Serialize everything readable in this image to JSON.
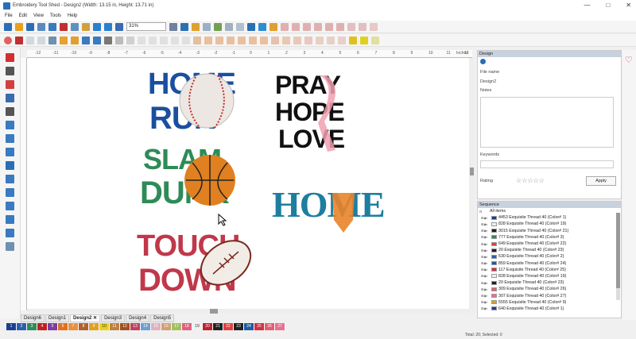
{
  "window": {
    "title": "Embroidery Tool Shed - Design2 (Width: 13.15 in, Height: 13.71 in)",
    "min": "—",
    "max": "□",
    "close": "✕"
  },
  "menu": [
    "File",
    "Edit",
    "View",
    "Tools",
    "Help"
  ],
  "toolbar": {
    "zoom": "31%"
  },
  "ruler": {
    "units": "Inches",
    "ticks": [
      "-12",
      "-11",
      "-10",
      "-9",
      "-8",
      "-7",
      "-6",
      "-5",
      "-4",
      "-3",
      "-2",
      "-1",
      "0",
      "1",
      "2",
      "3",
      "4",
      "5",
      "6",
      "7",
      "8",
      "9",
      "10",
      "11",
      "12"
    ]
  },
  "canvas": {
    "designs": [
      {
        "name": "home-run",
        "line1": "HOME",
        "line2": "RUN",
        "color": "#1a4fa0"
      },
      {
        "name": "pray-hope-love",
        "line1": "PRAY",
        "line2": "HOPE",
        "line3": "LOVE",
        "color": "#111111",
        "accent": "#f0a0b0"
      },
      {
        "name": "slam-dunk",
        "line1": "SLAM",
        "line2": "DUNK",
        "c1": "#2e8b57",
        "c2": "#e08020",
        "c3": "#1b6fa0"
      },
      {
        "name": "home",
        "line1": "HOME",
        "color": "#1e7ea0",
        "accent": "#e8842a"
      },
      {
        "name": "touch-down",
        "line1": "TOUCH",
        "line2": "DOWN",
        "color": "#c0384a"
      }
    ]
  },
  "design_tabs": [
    {
      "label": "Design6",
      "active": false
    },
    {
      "label": "Design1",
      "active": false
    },
    {
      "label": "Design2",
      "active": true,
      "close": "✕"
    },
    {
      "label": "Design3",
      "active": false
    },
    {
      "label": "Design4",
      "active": false
    },
    {
      "label": "Design5",
      "active": false
    }
  ],
  "palette": [
    {
      "n": "1",
      "c": "#1a3f8f"
    },
    {
      "n": "2",
      "c": "#2a5fb0"
    },
    {
      "n": "3",
      "c": "#2e8b57"
    },
    {
      "n": "4",
      "c": "#c02020"
    },
    {
      "n": "5",
      "c": "#7a3fa0"
    },
    {
      "n": "6",
      "c": "#e07020"
    },
    {
      "n": "7",
      "c": "#e89040"
    },
    {
      "n": "8",
      "c": "#b06030"
    },
    {
      "n": "9",
      "c": "#e0a020"
    },
    {
      "n": "10",
      "c": "#e8d020"
    },
    {
      "n": "11",
      "c": "#c08040"
    },
    {
      "n": "12",
      "c": "#a05020"
    },
    {
      "n": "13",
      "c": "#c04060"
    },
    {
      "n": "14",
      "c": "#6a9fd0"
    },
    {
      "n": "15",
      "c": "#e0b0c0"
    },
    {
      "n": "16",
      "c": "#d0a070"
    },
    {
      "n": "17",
      "c": "#a0c060"
    },
    {
      "n": "18",
      "c": "#e06080"
    },
    {
      "n": "19",
      "c": "#f0f0f0"
    },
    {
      "n": "20",
      "c": "#c02030"
    },
    {
      "n": "21",
      "c": "#202020"
    },
    {
      "n": "22",
      "c": "#e04040"
    },
    {
      "n": "23",
      "c": "#202020"
    },
    {
      "n": "24",
      "c": "#1a5fa0"
    },
    {
      "n": "25",
      "c": "#d03040"
    },
    {
      "n": "26",
      "c": "#e06070"
    },
    {
      "n": "27",
      "c": "#e87090"
    }
  ],
  "design_panel": {
    "header": "Design",
    "file_name_label": "File name",
    "file_name_value": "Design2",
    "notes_label": "Notes",
    "keywords_label": "Keywords",
    "rating_label": "Rating",
    "rating_stars": "☆☆☆☆☆",
    "apply_label": "Apply"
  },
  "sequence_panel": {
    "header": "Sequence",
    "all_items": "All items",
    "items": [
      {
        "label": "4453 Exquisite Thread 40 (Color# 1)",
        "c": "#1a3f8f"
      },
      {
        "label": "828 Exquisite Thread 40 (Color# 19)",
        "c": "#f0f0f0"
      },
      {
        "label": "3015 Exquisite Thread 40 (Color# 21)",
        "c": "#202020"
      },
      {
        "label": "777 Exquisite Thread 40 (Color# 3)",
        "c": "#2e8b57"
      },
      {
        "label": "649 Exquisite Thread 40 (Color# 22)",
        "c": "#e04040"
      },
      {
        "label": "20 Exquisite Thread 40 (Color# 23)",
        "c": "#202020"
      },
      {
        "label": "530 Exquisite Thread 40 (Color# 2)",
        "c": "#2a5fb0"
      },
      {
        "label": "859 Exquisite Thread 40 (Color# 24)",
        "c": "#1a5fa0"
      },
      {
        "label": "117 Exquisite Thread 40 (Color# 25)",
        "c": "#d03040"
      },
      {
        "label": "828 Exquisite Thread 40 (Color# 19)",
        "c": "#f0f0f0"
      },
      {
        "label": "20 Exquisite Thread 40 (Color# 23)",
        "c": "#202020"
      },
      {
        "label": "309 Exquisite Thread 40 (Color# 26)",
        "c": "#e06070"
      },
      {
        "label": "307 Exquisite Thread 40 (Color# 27)",
        "c": "#e87090"
      },
      {
        "label": "5555 Exquisite Thread 40 (Color# 9)",
        "c": "#e0a020"
      },
      {
        "label": "640 Exquisite Thread 40 (Color# 1)",
        "c": "#1a3f8f"
      }
    ]
  },
  "status": {
    "text": "Total: 20; Selected: 0"
  }
}
